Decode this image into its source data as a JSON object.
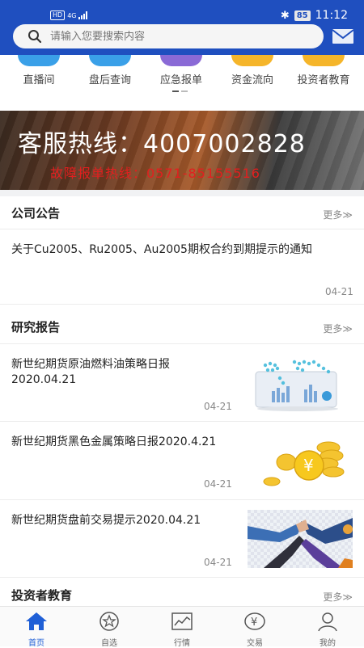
{
  "status": {
    "hd": "HD",
    "network": "4G",
    "battery": "85",
    "time": "11:12"
  },
  "search": {
    "placeholder": "请输入您要搜索内容"
  },
  "quick_menu": [
    {
      "label": "直播间",
      "color": "#3aa0e8"
    },
    {
      "label": "盘后查询",
      "color": "#3aa0e8"
    },
    {
      "label": "应急报单",
      "color": "#8a6ad6"
    },
    {
      "label": "资金流向",
      "color": "#f5b52a"
    },
    {
      "label": "投资者教育",
      "color": "#f5b52a"
    }
  ],
  "banner": {
    "hotline": "客服热线：4007002828",
    "fault_line": "故障报单热线：0571-85155516"
  },
  "announcements": {
    "title": "公司公告",
    "more": "更多≫",
    "items": [
      {
        "title": "关于Cu2005、Ru2005、Au2005期权合约到期提示的通知",
        "date": "04-21"
      }
    ]
  },
  "research": {
    "title": "研究报告",
    "more": "更多≫",
    "items": [
      {
        "title": "新世纪期货原油燃料油策略日报2020.04.21",
        "date": "04-21",
        "thumb": "world-map-tablet"
      },
      {
        "title": "新世纪期货黑色金属策略日报2020.4.21",
        "date": "04-21",
        "thumb": "gold-coins-yen"
      },
      {
        "title": "新世纪期货盘前交易提示2020.04.21",
        "date": "04-21",
        "thumb": "team-hands-together"
      }
    ]
  },
  "education": {
    "title": "投资者教育",
    "more": "更多≫"
  },
  "tabbar": [
    {
      "label": "首页",
      "icon": "home-icon",
      "active": true
    },
    {
      "label": "自选",
      "icon": "star-icon",
      "active": false
    },
    {
      "label": "行情",
      "icon": "chart-icon",
      "active": false
    },
    {
      "label": "交易",
      "icon": "yen-icon",
      "active": false
    },
    {
      "label": "我的",
      "icon": "user-icon",
      "active": false
    }
  ]
}
